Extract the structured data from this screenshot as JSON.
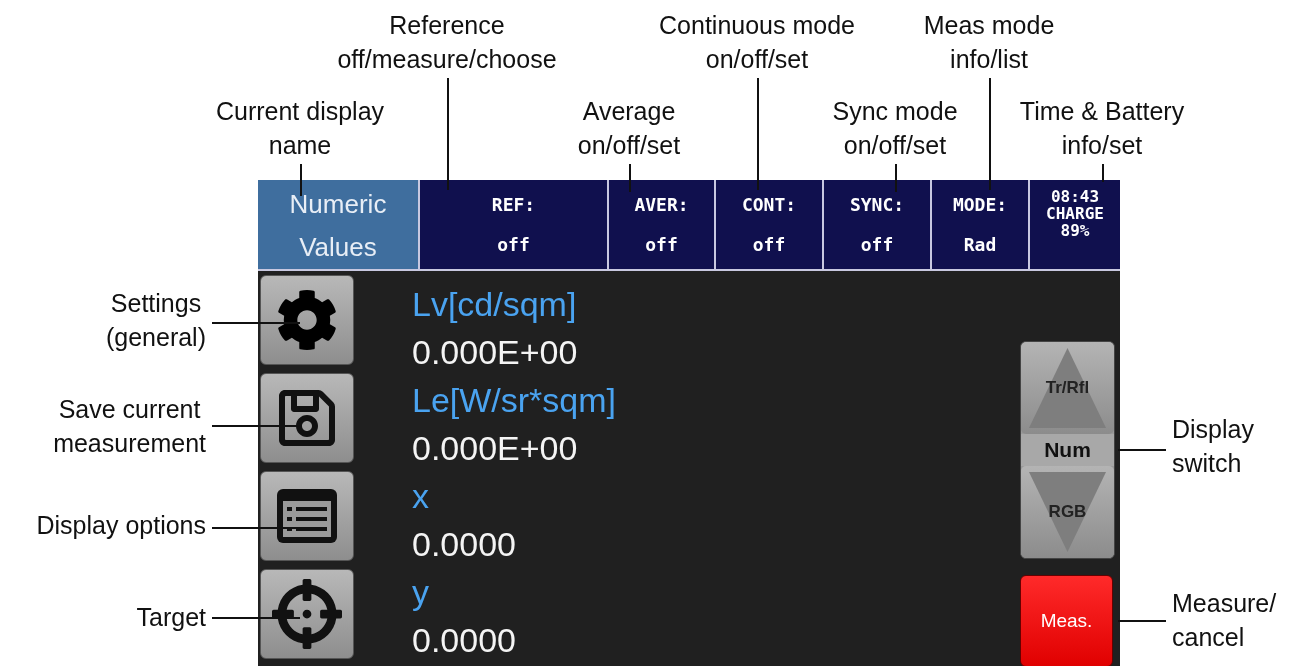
{
  "annotations_top": [
    "Reference\noff/measure/choose",
    "Continuous mode\non/off/set",
    "Meas mode\ninfo/list",
    "Current display\nname",
    "Average\non/off/set",
    "Sync mode\non/off/set",
    "Time & Battery\ninfo/set"
  ],
  "annotations_left": [
    "Settings\n(general)",
    "Save current\nmeasurement",
    "Display options",
    "Target"
  ],
  "annotations_right": [
    "Display\nswitch",
    "Measure/\ncancel"
  ],
  "screen": {
    "header": [
      {
        "kind": "title",
        "text": "Numeric\nValues"
      },
      {
        "kind": "status",
        "label": "REF:",
        "value": "off"
      },
      {
        "kind": "status",
        "label": "AVER:",
        "value": "off"
      },
      {
        "kind": "status",
        "label": "CONT:",
        "value": "off"
      },
      {
        "kind": "status",
        "label": "SYNC:",
        "value": "off"
      },
      {
        "kind": "status",
        "label": "MODE:",
        "value": "Rad"
      },
      {
        "kind": "clock",
        "time": "08:43",
        "charge": "CHARGE",
        "percent": "89%"
      }
    ],
    "side_buttons": [
      {
        "kind": "gear"
      },
      {
        "kind": "floppy"
      },
      {
        "kind": "list"
      },
      {
        "kind": "target"
      }
    ],
    "readings": [
      {
        "label": "Lv[cd/sqm]",
        "value": "0.000E+00"
      },
      {
        "label": "Le[W/sr*sqm]",
        "value": "0.000E+00"
      },
      {
        "label": "x",
        "value": "0.0000"
      },
      {
        "label": "y",
        "value": "0.0000"
      }
    ],
    "display_switch": {
      "up": "Tr/Rfl",
      "current": "Num",
      "down": "RGB"
    },
    "measure_button": "Meas."
  }
}
